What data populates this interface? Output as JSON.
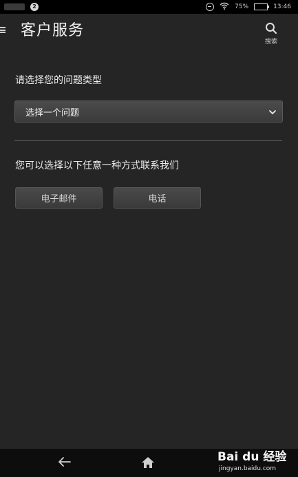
{
  "status_bar": {
    "notification_count": "2",
    "battery": "75%",
    "battery_level": 0.75,
    "time": "13:46"
  },
  "header": {
    "title": "客户服务",
    "search_label": "搜索"
  },
  "issue": {
    "label": "请选择您的问题类型",
    "select_value": "选择一个问题"
  },
  "contact": {
    "label": "您可以选择以下任意一种方式联系我们",
    "email_button": "电子邮件",
    "phone_button": "电话"
  },
  "watermark": {
    "brand": "Bai du 经验",
    "url": "jingyan.baidu.com"
  },
  "icons": [
    "menu-icon",
    "search-icon",
    "chevron-down-icon",
    "back-icon",
    "home-icon",
    "wifi-icon",
    "dnd-icon",
    "battery-icon"
  ]
}
